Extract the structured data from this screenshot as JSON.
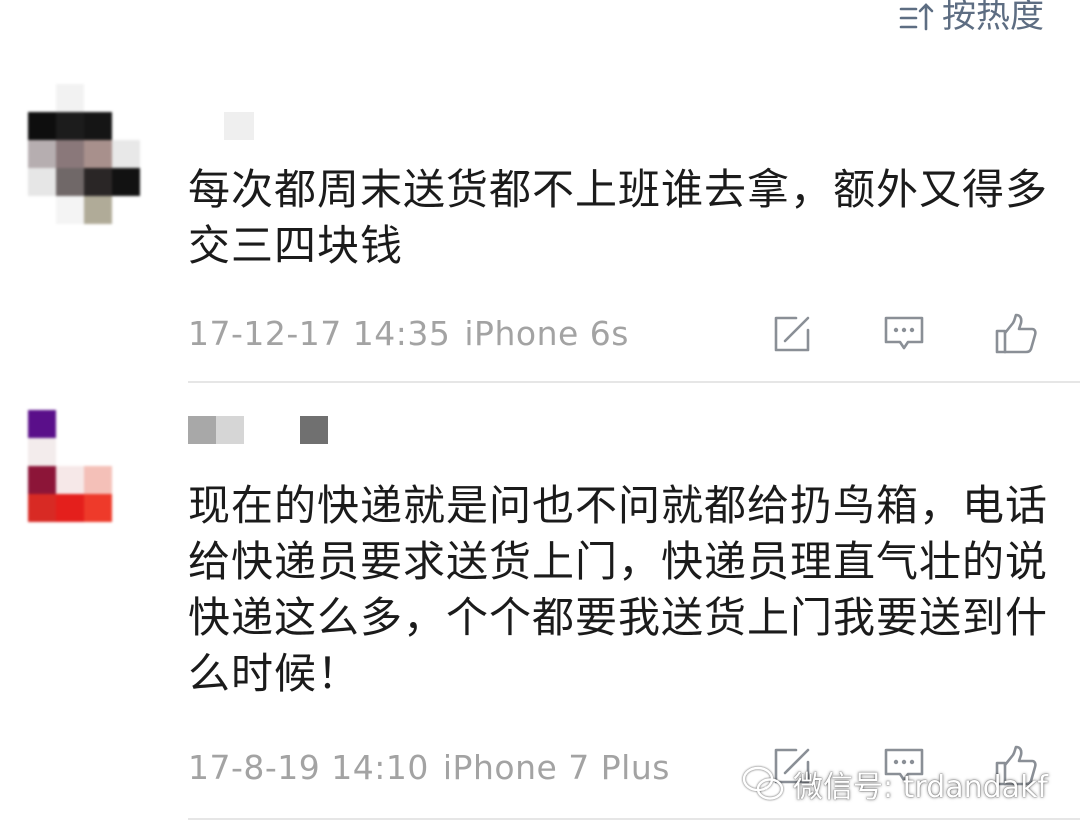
{
  "sort": {
    "label": "按热度",
    "icon": "sort-lines-arrow-icon"
  },
  "colors": {
    "text": "#1b1b1b",
    "meta": "#a3a3a3",
    "icon": "#8a8f96",
    "accent": "#5d6d82",
    "divider": "#e6e6e6"
  },
  "comments": [
    {
      "text": "每次都周末送货都不上班谁去拿，额外又得多交三四块钱",
      "date": "17-12-17 14:35",
      "device": "iPhone 6s",
      "actions": [
        "repost-icon",
        "reply-icon",
        "like-icon"
      ]
    },
    {
      "text": "现在的快递就是问也不问就都给扔鸟箱，电话给快递员要求送货上门，快递员理直气壮的说快递这么多，个个都要我送货上门我要送到什么时候！",
      "date": "17-8-19 14:10",
      "device": "iPhone 7 Plus",
      "actions": [
        "repost-icon",
        "reply-icon",
        "like-icon"
      ]
    }
  ],
  "watermark": {
    "label": "微信号: trdandakf",
    "icon": "wechat-logo-icon"
  }
}
